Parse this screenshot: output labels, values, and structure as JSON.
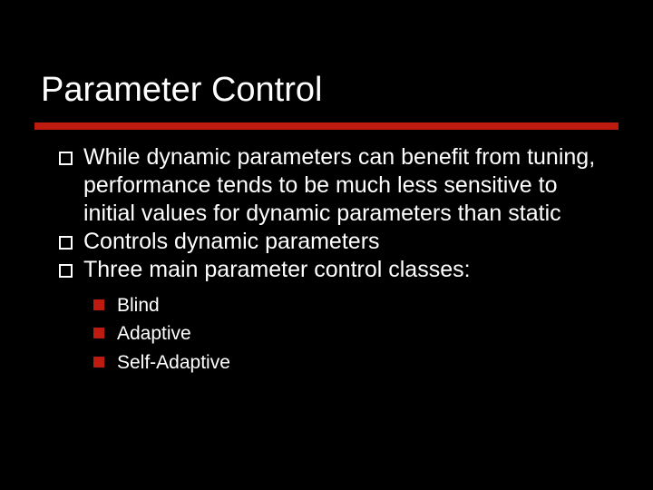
{
  "slide": {
    "title": "Parameter Control",
    "bullets": [
      {
        "text": "While dynamic parameters can benefit from tuning, performance tends to be much less sensitive to initial values for dynamic parameters than static"
      },
      {
        "text": "Controls dynamic parameters"
      },
      {
        "text": "Three main parameter control classes:"
      }
    ],
    "subbullets": [
      {
        "text": "Blind"
      },
      {
        "text": "Adaptive"
      },
      {
        "text": "Self-Adaptive"
      }
    ],
    "accent_color": "#bd1b0f"
  }
}
